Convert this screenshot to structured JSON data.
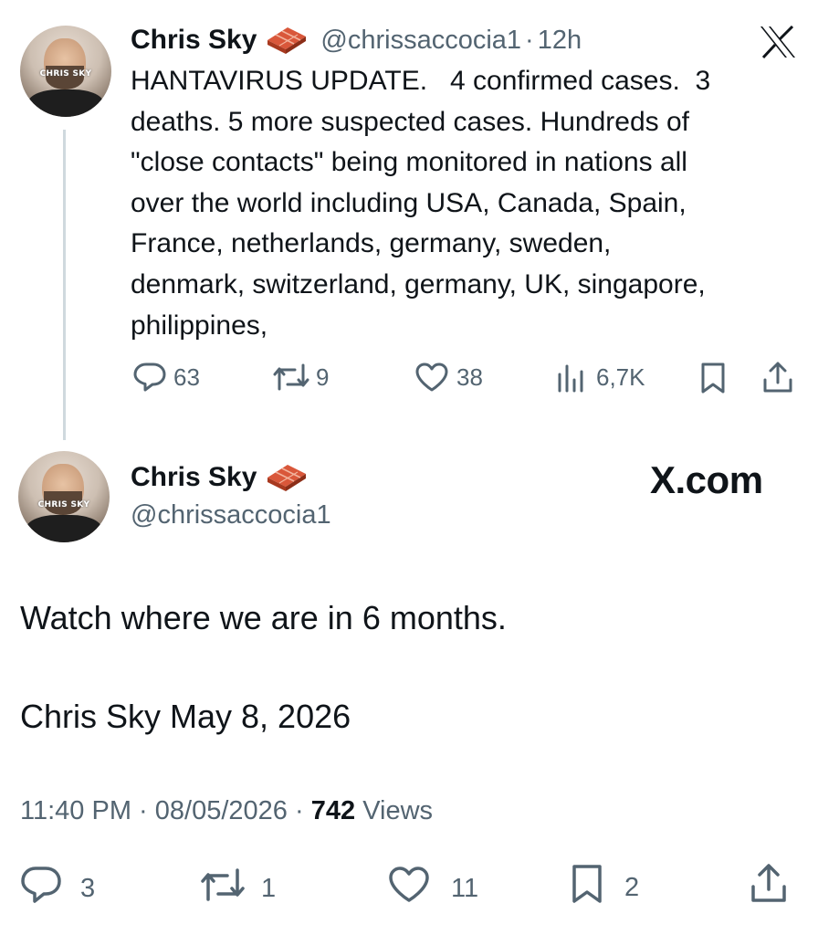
{
  "top_tweet": {
    "author_name": "Chris Sky",
    "handle": "@chrissaccocia1",
    "separator": "·",
    "time_ago": "12h",
    "avatar_brand": "CHRIS SKY",
    "text": "HANTAVIRUS UPDATE.   4 confirmed cases.  3 deaths. 5 more suspected cases. Hundreds of \"close contacts\" being monitored in nations all over the world including USA, Canada, Spain, France, netherlands, germany, sweden, denmark, switzerland, germany, UK, singapore, philippines,",
    "text_lines": [
      "HANTAVIRUS UPDATE.   4 confirmed cases.  3",
      "deaths. 5 more suspected cases. Hundreds of",
      "\"close contacts\" being monitored in nations all",
      "over the world including USA, Canada, Spain,",
      "France, netherlands, germany, sweden,",
      "denmark, switzerland, germany, UK, singapore,",
      "philippines,"
    ],
    "replies": "63",
    "reposts": "9",
    "likes": "38",
    "views": "6,7K"
  },
  "main_tweet": {
    "author_name": "Chris Sky",
    "handle": "@chrissaccocia1",
    "avatar_brand": "CHRIS SKY",
    "site_label": "X.com",
    "text_line1": "Watch where we are in 6 months.",
    "text_line2": "Chris Sky May 8, 2026",
    "time": "11:40 PM",
    "date": "08/05/2026",
    "dot": "·",
    "views_count": "742",
    "views_label": "Views",
    "replies": "3",
    "reposts": "1",
    "likes": "11",
    "bookmarks": "2"
  },
  "icons": {
    "brick": "brick-emoji-icon",
    "x_logo": "x-logo-icon",
    "reply": "reply-icon",
    "repost": "repost-icon",
    "like": "heart-icon",
    "views": "analytics-icon",
    "bookmark": "bookmark-icon",
    "share": "share-icon"
  },
  "colors": {
    "text": "#0f1419",
    "secondary": "#536471",
    "thread_line": "#cfd9de",
    "brick": "#c0452b"
  }
}
